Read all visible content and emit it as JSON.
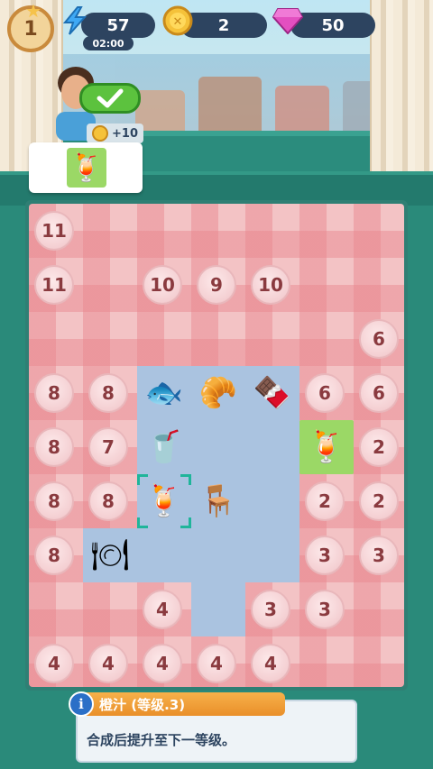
{
  "hud": {
    "level": "1",
    "energy": "57",
    "timer": "02:00",
    "coins": "2",
    "gems": "50"
  },
  "order": {
    "reward": "+10",
    "item_icon": "cocktail-icon"
  },
  "board": {
    "locked": [
      {
        "label": "11",
        "col": 0,
        "row": 0
      },
      {
        "label": "11",
        "col": 0,
        "row": 1
      },
      {
        "label": "10",
        "col": 2,
        "row": 1
      },
      {
        "label": "9",
        "col": 3,
        "row": 1
      },
      {
        "label": "10",
        "col": 4,
        "row": 1
      },
      {
        "label": "6",
        "col": 6,
        "row": 2
      },
      {
        "label": "8",
        "col": 0,
        "row": 3
      },
      {
        "label": "8",
        "col": 1,
        "row": 3
      },
      {
        "label": "6",
        "col": 5,
        "row": 3
      },
      {
        "label": "6",
        "col": 6,
        "row": 3
      },
      {
        "label": "8",
        "col": 0,
        "row": 4
      },
      {
        "label": "7",
        "col": 1,
        "row": 4
      },
      {
        "label": "2",
        "col": 6,
        "row": 4
      },
      {
        "label": "8",
        "col": 0,
        "row": 5
      },
      {
        "label": "8",
        "col": 1,
        "row": 5
      },
      {
        "label": "2",
        "col": 5,
        "row": 5
      },
      {
        "label": "2",
        "col": 6,
        "row": 5
      },
      {
        "label": "8",
        "col": 0,
        "row": 6
      },
      {
        "label": "3",
        "col": 5,
        "row": 6
      },
      {
        "label": "3",
        "col": 6,
        "row": 6
      },
      {
        "label": "4",
        "col": 2,
        "row": 7
      },
      {
        "label": "3",
        "col": 4,
        "row": 7
      },
      {
        "label": "3",
        "col": 5,
        "row": 7
      },
      {
        "label": "4",
        "col": 0,
        "row": 8
      },
      {
        "label": "4",
        "col": 1,
        "row": 8
      },
      {
        "label": "4",
        "col": 2,
        "row": 8
      },
      {
        "label": "4",
        "col": 3,
        "row": 8
      },
      {
        "label": "4",
        "col": 4,
        "row": 8
      }
    ],
    "items": [
      {
        "name": "fish-plate-item",
        "glyph": "🐟",
        "col": 2,
        "row": 3
      },
      {
        "name": "sausage-roll-item",
        "glyph": "🥐",
        "col": 3,
        "row": 3
      },
      {
        "name": "icecream-bar-item",
        "glyph": "🍫",
        "col": 4,
        "row": 3
      },
      {
        "name": "strawberry-smoothie-item",
        "glyph": "🥤",
        "col": 2,
        "row": 4
      },
      {
        "name": "cocktail-item",
        "glyph": "🍹",
        "col": 5,
        "row": 4
      },
      {
        "name": "orange-juice-item",
        "glyph": "🍹",
        "col": 2,
        "row": 5
      },
      {
        "name": "stool-generator-item",
        "glyph": "🪑",
        "col": 3,
        "row": 5
      },
      {
        "name": "empty-plate-item",
        "glyph": "🍽",
        "col": 1,
        "row": 6
      }
    ]
  },
  "info": {
    "title": "橙汁 (等级.3)",
    "description": "合成后提升至下一等级。"
  }
}
